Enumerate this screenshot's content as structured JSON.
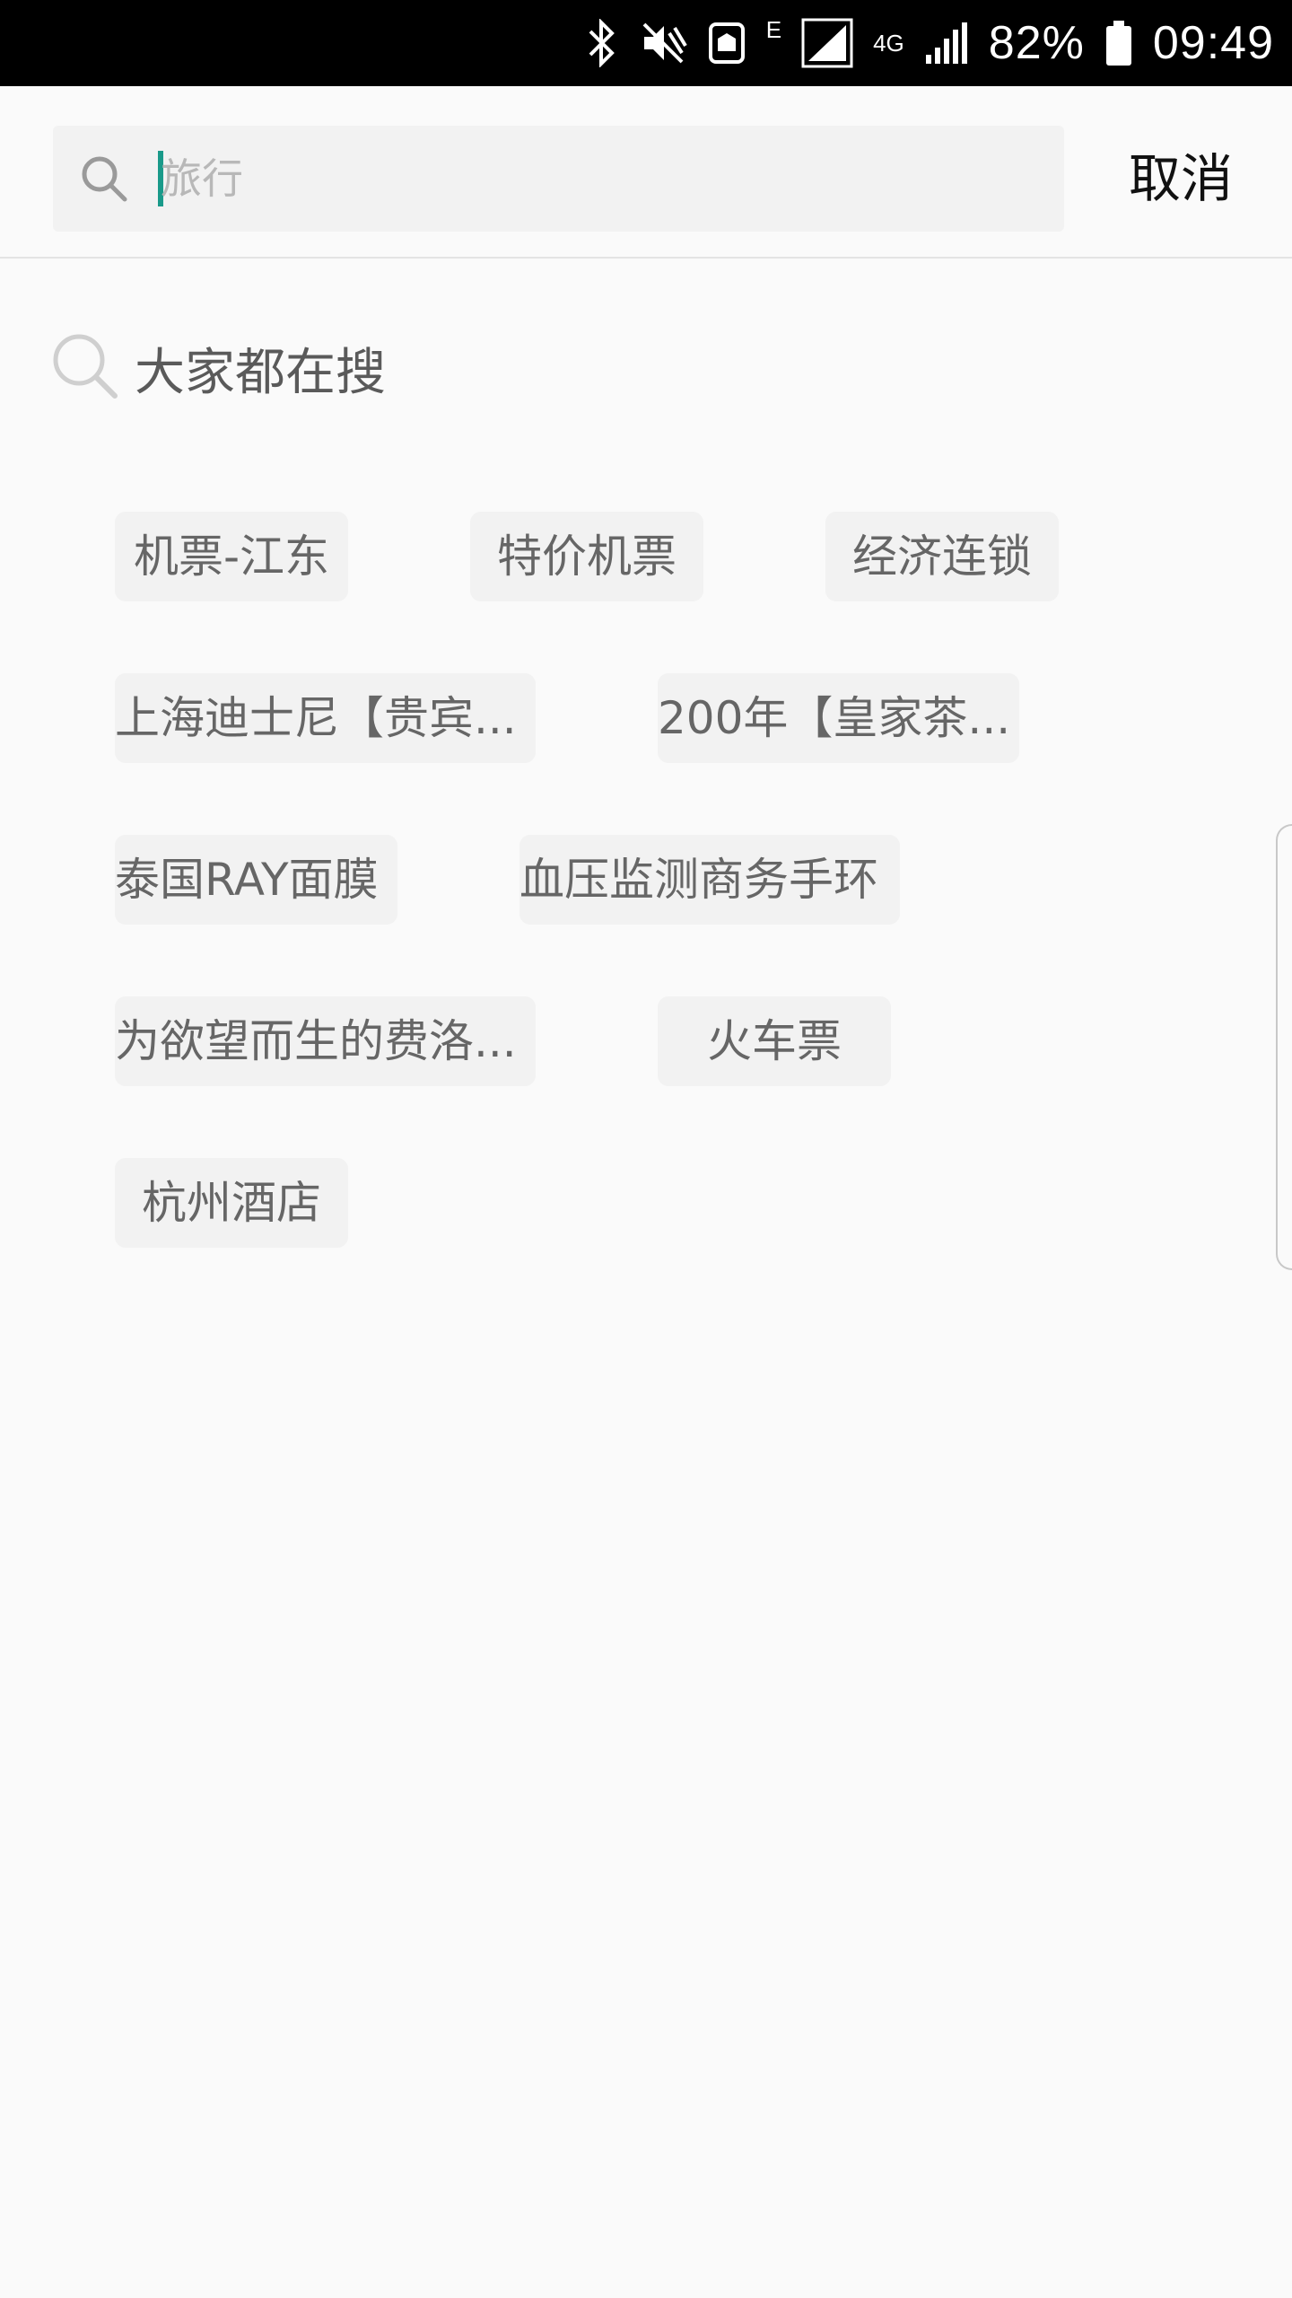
{
  "status_bar": {
    "icons": [
      "bluetooth-icon",
      "mute-icon",
      "nfc-icon",
      "signal-icon",
      "signal-icon"
    ],
    "network_e": "E",
    "network_4g": "4G",
    "battery": "82%",
    "time": "09:49"
  },
  "search": {
    "placeholder": "旅行",
    "value": "",
    "cancel_label": "取消"
  },
  "hot": {
    "title": "大家都在搜",
    "tags": [
      "机票-江东",
      "特价机票",
      "经济连锁",
      "上海迪士尼【贵宾...",
      "200年【皇家茶...",
      "泰国RAY面膜",
      "血压监测商务手环",
      "为欲望而生的费洛...",
      "火车票",
      "杭州酒店"
    ]
  }
}
